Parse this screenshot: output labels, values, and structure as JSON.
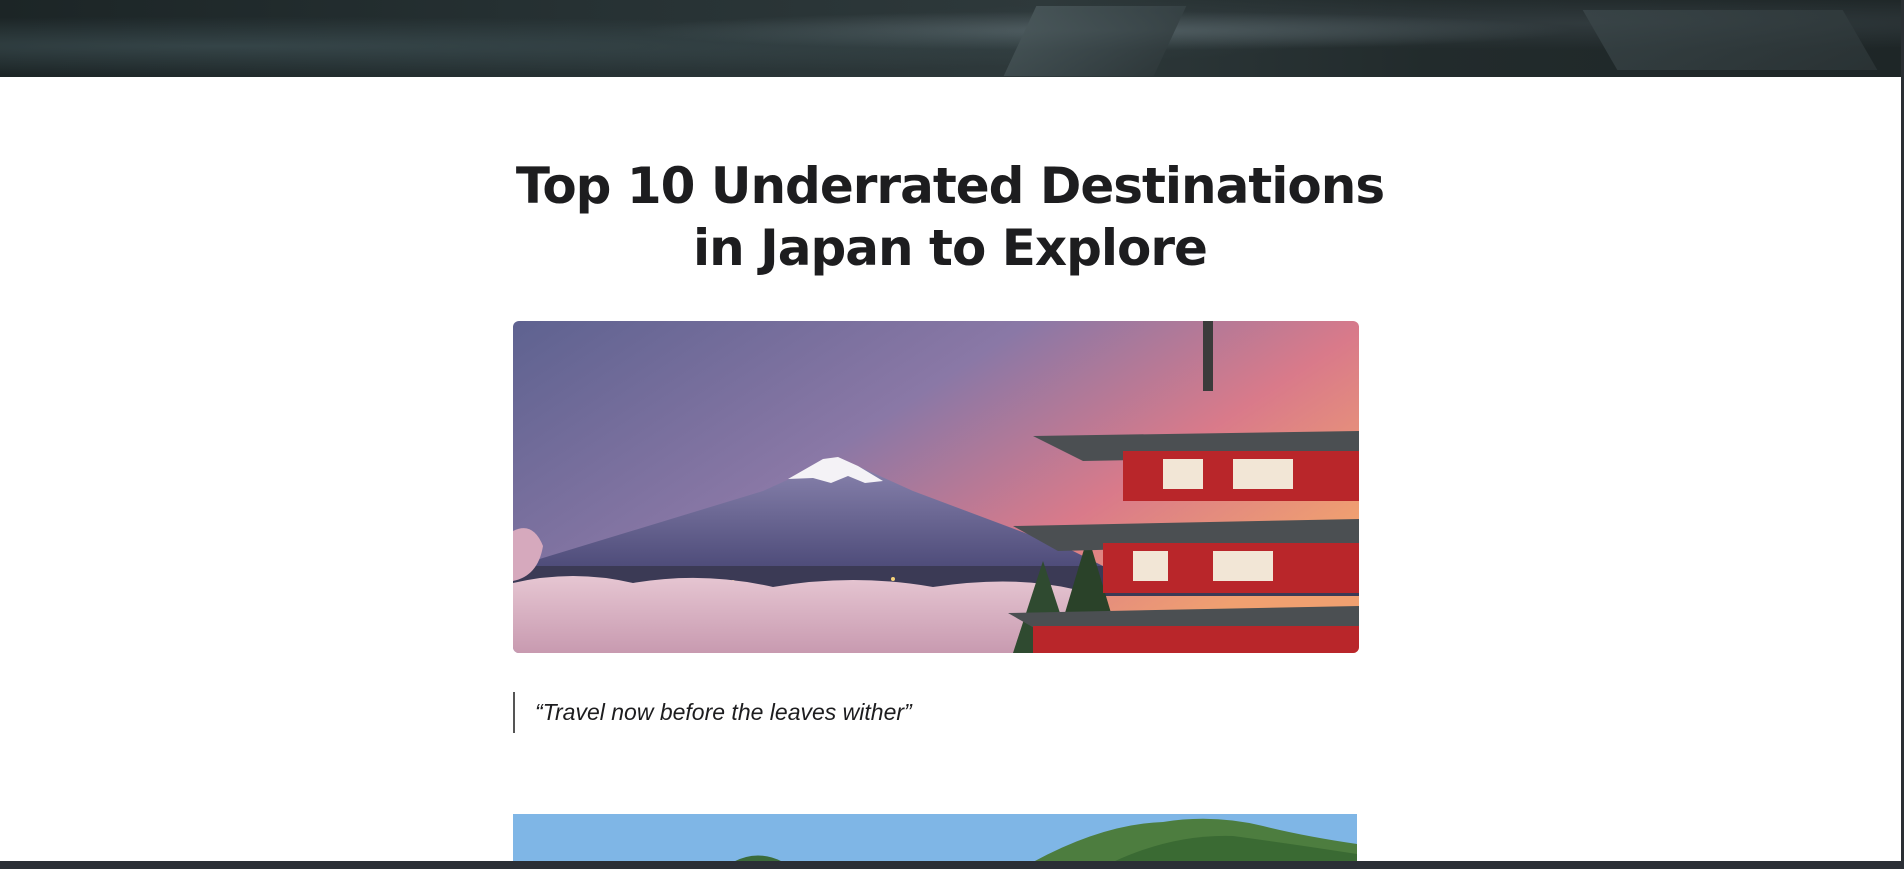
{
  "article": {
    "title_line1": "Top 10 Underrated Destinations",
    "title_line2": "in Japan to Explore",
    "quote": "“Travel now before the leaves wither”"
  },
  "images": {
    "hero_image_icon": "pagoda-mount-fuji-image-icon",
    "second_image_icon": "green-mountain-image-icon",
    "header_image_icon": "header-background-image-icon"
  },
  "colors": {
    "title": "#1d1d1f",
    "quote_border": "#555555",
    "header_bg": "#222b2c",
    "taskbar": "#2b2f36"
  }
}
